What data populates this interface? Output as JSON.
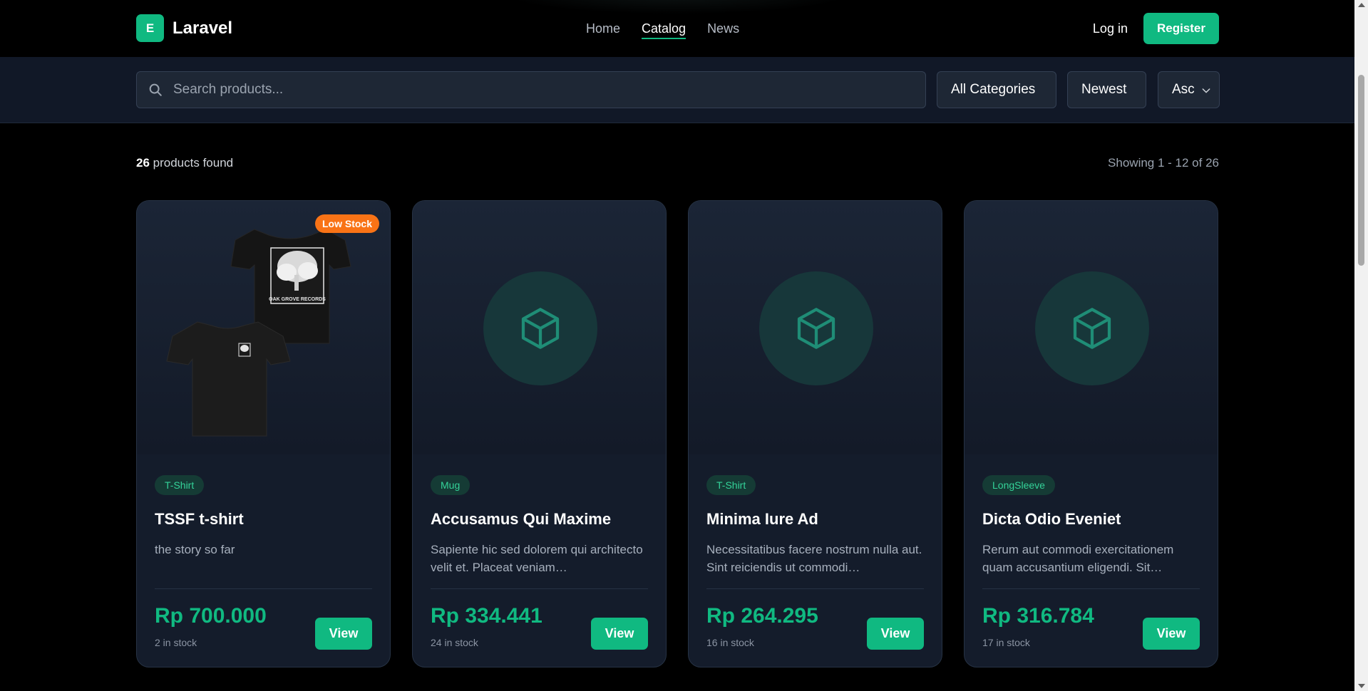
{
  "header": {
    "brand_mark": "E",
    "brand_name": "Laravel",
    "nav": [
      {
        "label": "Home"
      },
      {
        "label": "Catalog"
      },
      {
        "label": "News"
      }
    ],
    "login_label": "Log in",
    "register_label": "Register"
  },
  "filters": {
    "search_placeholder": "Search products...",
    "category": "All Categories",
    "sort": "Newest",
    "direction": "Asc"
  },
  "results": {
    "count": "26",
    "count_suffix": " products found",
    "showing": "Showing 1 - 12 of 26"
  },
  "products": [
    {
      "badge": "Low Stock",
      "tag": "T-Shirt",
      "title": "TSSF t-shirt",
      "description": "the story so far",
      "price": "Rp 700.000",
      "stock": "2 in stock",
      "view_label": "View",
      "image_text": "OAK GROVE RECORDS"
    },
    {
      "tag": "Mug",
      "title": "Accusamus Qui Maxime",
      "description": "Sapiente hic sed dolorem qui architecto velit et. Placeat veniam…",
      "price": "Rp 334.441",
      "stock": "24 in stock",
      "view_label": "View"
    },
    {
      "tag": "T-Shirt",
      "title": "Minima Iure Ad",
      "description": "Necessitatibus facere nostrum nulla aut. Sint reiciendis ut commodi…",
      "price": "Rp 264.295",
      "stock": "16 in stock",
      "view_label": "View"
    },
    {
      "tag": "LongSleeve",
      "title": "Dicta Odio Eveniet",
      "description": "Rerum aut commodi exercitationem quam accusantium eligendi. Sit…",
      "price": "Rp 316.784",
      "stock": "17 in stock",
      "view_label": "View"
    }
  ],
  "colors": {
    "accent": "#10b981",
    "badge": "#f97316",
    "card_bg": "#141c2b",
    "page_bg": "#000000"
  },
  "icons": [
    "search-icon",
    "chevron-down-icon",
    "box-icon"
  ]
}
